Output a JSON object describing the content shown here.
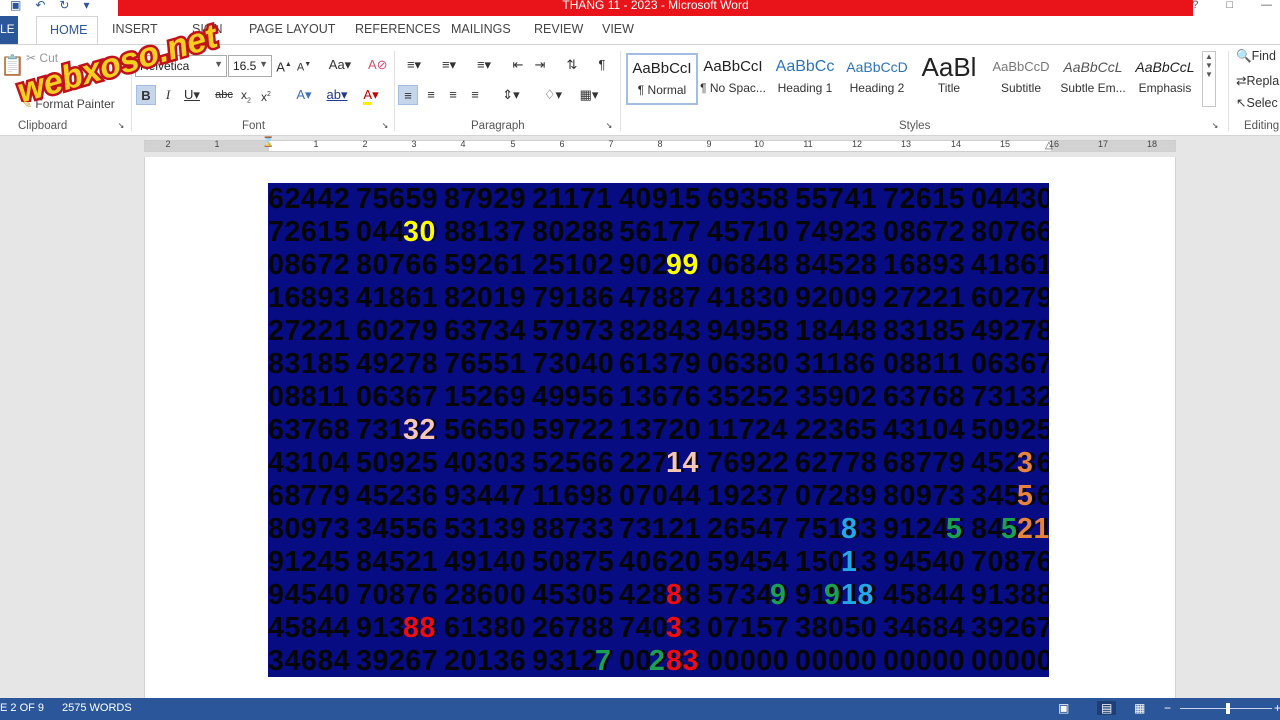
{
  "window": {
    "title": "THANG 11 - 2023 -  Microsoft Word"
  },
  "tabs": [
    "FILE",
    "HOME",
    "INSERT",
    "DESIGN",
    "PAGE LAYOUT",
    "REFERENCES",
    "MAILINGS",
    "REVIEW",
    "VIEW"
  ],
  "tab_display": {
    "file": "LE",
    "home": "HOME",
    "insert": "INSERT",
    "design": "SIGN",
    "layout": "PAGE LAYOUT",
    "references": "REFERENCES",
    "mailings": "MAILINGS",
    "review": "REVIEW",
    "view": "VIEW"
  },
  "clipboard": {
    "cut": "Cut",
    "format_painter": "Format Painter",
    "label": "Clipboard"
  },
  "font": {
    "name": "Helvetica",
    "size": "16.5",
    "label": "Font"
  },
  "paragraph": {
    "label": "Paragraph"
  },
  "styles": {
    "label": "Styles",
    "items": [
      {
        "preview": "AaBbCcI",
        "name": "¶ Normal"
      },
      {
        "preview": "AaBbCcI",
        "name": "¶ No Spac..."
      },
      {
        "preview": "AaBbCc",
        "name": "Heading 1"
      },
      {
        "preview": "AaBbCcD",
        "name": "Heading 2"
      },
      {
        "preview": "AaBl",
        "name": "Title"
      },
      {
        "preview": "AaBbCcD",
        "name": "Subtitle"
      },
      {
        "preview": "AaBbCcL",
        "name": "Subtle Em..."
      },
      {
        "preview": "AaBbCcL",
        "name": "Emphasis"
      }
    ]
  },
  "editing": {
    "find": "Find",
    "replace": "Repla",
    "select": "Selec",
    "label": "Editing"
  },
  "ruler": {
    "numbers": [
      "2",
      "1",
      "1",
      "2",
      "3",
      "4",
      "5",
      "6",
      "7",
      "8",
      "9",
      "10",
      "11",
      "12",
      "13",
      "14",
      "15",
      "16",
      "17",
      "18"
    ]
  },
  "document": {
    "rows": [
      "62442 75659 87929 21171 40915 69358 55741 72615 04430",
      "72615 04430 88137 80288 56177 45710 74923 08672 80766",
      "08672 80766 59261 25102 90299 06848 84528 16893 41861",
      "16893 41861 82019 79186 47887 41830 92009 27221 60279",
      "27221 60279 63734 57973 82843 94958 18448 83185 49278",
      "83185 49278 76551 73040 61379 06380 31186 08811 06367",
      "08811 06367 15269 49956 13676 35252 35902 63768 73132",
      "63768 73132 56650 59722 13720 11724 22365 43104 50925",
      "43104 50925 40303 52566 22714 76922 62778 68779 45236",
      "68779 45236 93447 11698 07044 19237 07289 80973 34556",
      "80973 34556 53139 88733 73121 26547 75183 91245 84521",
      "91245 84521 49140 50875 40620 59454 15013 94540 70876",
      "94540 70876 28600 45305 42888 57349 91918 45844 91388",
      "45844 91388 61380 26788 74033 07157 38050 34684 39267",
      "34684 39267 20136 93127 00283 00000 00000 00000 00000"
    ],
    "highlights": [
      {
        "text": "30",
        "color": "#ffff00"
      },
      {
        "text": "99",
        "color": "#ffff00"
      },
      {
        "text": "32",
        "color": "#f6c7b4"
      },
      {
        "text": "14",
        "color": "#f6c7b4"
      },
      {
        "text": "3",
        "color": "#e8823f"
      },
      {
        "text": "5",
        "color": "#e8823f"
      },
      {
        "text": "8",
        "color": "#22a8e6"
      },
      {
        "text": "5",
        "color": "#1aa050"
      },
      {
        "text": "5",
        "color": "#1aa050"
      },
      {
        "text": "21",
        "color": "#e8823f"
      },
      {
        "text": "1",
        "color": "#22a8e6"
      },
      {
        "text": "8",
        "color": "#f00a14"
      },
      {
        "text": "9",
        "color": "#1aa050"
      },
      {
        "text": "9",
        "color": "#1aa050"
      },
      {
        "text": "18",
        "color": "#22a8e6"
      },
      {
        "text": "88",
        "color": "#f00a14"
      },
      {
        "text": "3",
        "color": "#f00a14"
      },
      {
        "text": "7",
        "color": "#1aa050"
      },
      {
        "text": "2",
        "color": "#1aa050"
      },
      {
        "text": "83",
        "color": "#f00a14"
      }
    ]
  },
  "status": {
    "page": "E 2 OF 9",
    "words": "2575 WORDS"
  },
  "watermark": {
    "text": "webxoso.net"
  }
}
